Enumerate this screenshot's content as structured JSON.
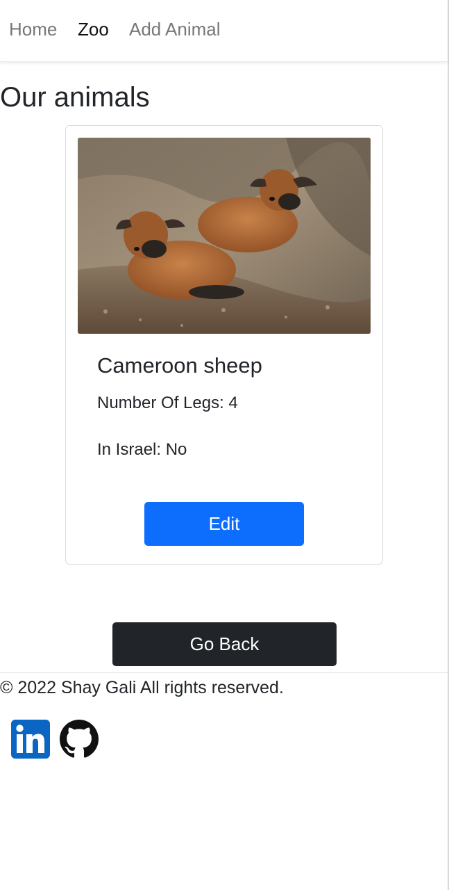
{
  "nav": {
    "items": [
      {
        "label": "Home",
        "active": false
      },
      {
        "label": "Zoo",
        "active": true
      },
      {
        "label": "Add Animal",
        "active": false
      }
    ]
  },
  "page": {
    "title": "Our animals"
  },
  "animal": {
    "name": "Cameroon sheep",
    "legs_text": "Number Of Legs: 4",
    "israel_text": "In Israel: No",
    "image_icon": "animal-photo",
    "edit_label": "Edit"
  },
  "actions": {
    "go_back_label": "Go Back"
  },
  "footer": {
    "copyright": "© 2022 Shay Gali All rights reserved.",
    "social": [
      {
        "icon": "linkedin-icon",
        "color": "#0a66c2"
      },
      {
        "icon": "github-icon",
        "color": "#111111"
      }
    ]
  },
  "colors": {
    "primary": "#0d6efd",
    "dark": "#212529",
    "nav_inactive": "#777777"
  }
}
